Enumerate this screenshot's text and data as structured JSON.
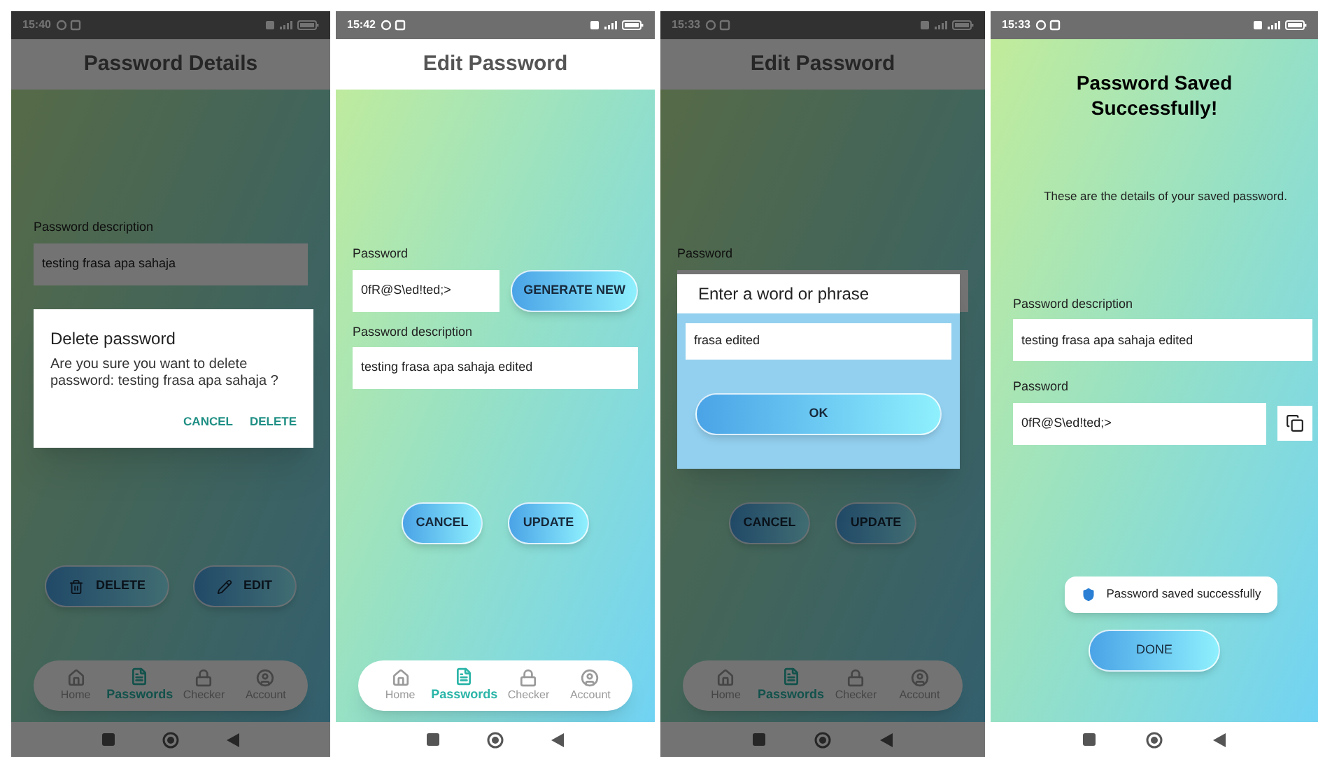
{
  "screens": [
    {
      "kind": "details",
      "time": "15:40",
      "title": "Password Details",
      "dimmed": true,
      "fields": [
        {
          "label": "Password description",
          "value": "testing frasa apa sahaja"
        }
      ],
      "actions": [
        "DELETE",
        "EDIT"
      ],
      "dialog": {
        "kind": "confirm",
        "title": "Delete password",
        "message": "Are you sure you want to delete password: testing frasa apa sahaja ?",
        "buttons": [
          "CANCEL",
          "DELETE"
        ]
      },
      "nav": [
        {
          "label": "Home",
          "selected": false
        },
        {
          "label": "Passwords",
          "selected": true
        },
        {
          "label": "Checker",
          "selected": false
        },
        {
          "label": "Account",
          "selected": false
        }
      ]
    },
    {
      "kind": "edit",
      "time": "15:42",
      "title": "Edit Password",
      "fields": [
        {
          "label": "Password",
          "value": "0fR@S\\ed!ted;>",
          "button": "GENERATE NEW"
        },
        {
          "label": "Password description",
          "value": "testing frasa apa sahaja edited"
        }
      ],
      "actions": [
        "CANCEL",
        "UPDATE"
      ],
      "nav": [
        {
          "label": "Home",
          "selected": false
        },
        {
          "label": "Passwords",
          "selected": true
        },
        {
          "label": "Checker",
          "selected": false
        },
        {
          "label": "Account",
          "selected": false
        }
      ]
    },
    {
      "kind": "edit",
      "time": "15:33",
      "title": "Edit Password",
      "dimmed": true,
      "fields": [
        {
          "label": "Password"
        }
      ],
      "actions": [
        "CANCEL",
        "UPDATE"
      ],
      "dialog": {
        "kind": "prompt",
        "title": "Enter a word or phrase",
        "value": "frasa edited",
        "buttons": [
          "OK"
        ]
      },
      "nav": [
        {
          "label": "Home",
          "selected": false
        },
        {
          "label": "Passwords",
          "selected": true
        },
        {
          "label": "Checker",
          "selected": false
        },
        {
          "label": "Account",
          "selected": false
        }
      ]
    },
    {
      "kind": "saved",
      "time": "15:33",
      "title": "Password Saved Successfully!",
      "subtitle": "These are the details of your saved password.",
      "fields": [
        {
          "label": "Password description",
          "value": "testing frasa apa sahaja edited"
        },
        {
          "label": "Password",
          "value": "0fR@S\\ed!ted;>",
          "copyable": true
        }
      ],
      "toast": "Password saved successfully",
      "actions": [
        "DONE"
      ]
    }
  ]
}
